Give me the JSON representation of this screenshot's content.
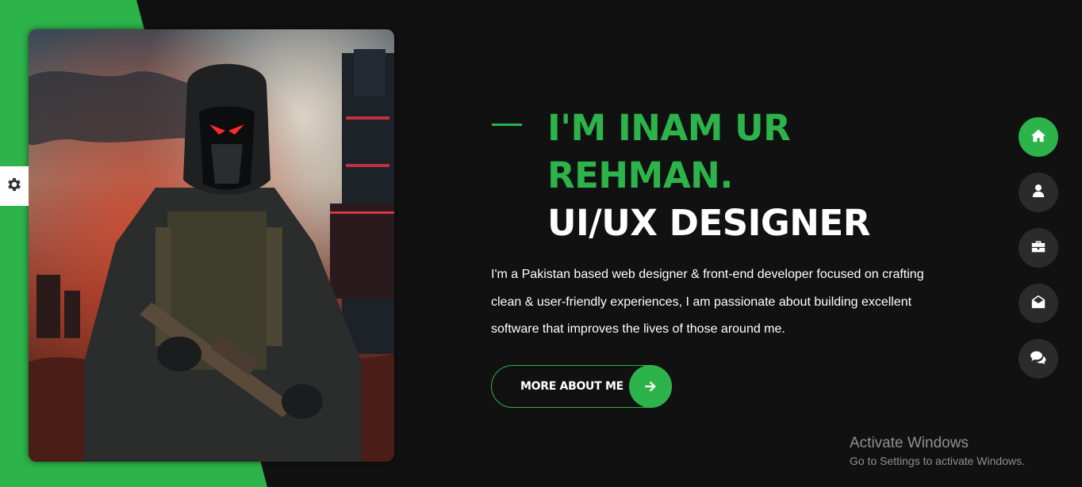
{
  "colors": {
    "accent": "#2cb34a",
    "background": "#111111",
    "nav_inactive": "#2b2b2b",
    "text": "#ffffff"
  },
  "hero": {
    "name_line1": "I'M INAM UR",
    "name_line2": "REHMAN.",
    "role": "UI/UX DESIGNER",
    "bio_line1": "I'm a Pakistan based web designer & front-end developer focused on crafting",
    "bio_line2": "clean & user-friendly experiences, I am passionate about building excellent",
    "bio_line3": "software that improves the lives of those around me.",
    "cta_label": "MORE ABOUT ME",
    "cta_icon": "arrow-right-icon",
    "image": "hooded-soldier-portrait"
  },
  "settings": {
    "icon": "gear-icon"
  },
  "side_nav": {
    "items": [
      {
        "icon": "home-icon",
        "active": true
      },
      {
        "icon": "user-icon",
        "active": false
      },
      {
        "icon": "briefcase-icon",
        "active": false
      },
      {
        "icon": "envelope-open-icon",
        "active": false
      },
      {
        "icon": "comments-icon",
        "active": false
      }
    ]
  },
  "watermark": {
    "title": "Activate Windows",
    "subtitle": "Go to Settings to activate Windows."
  }
}
